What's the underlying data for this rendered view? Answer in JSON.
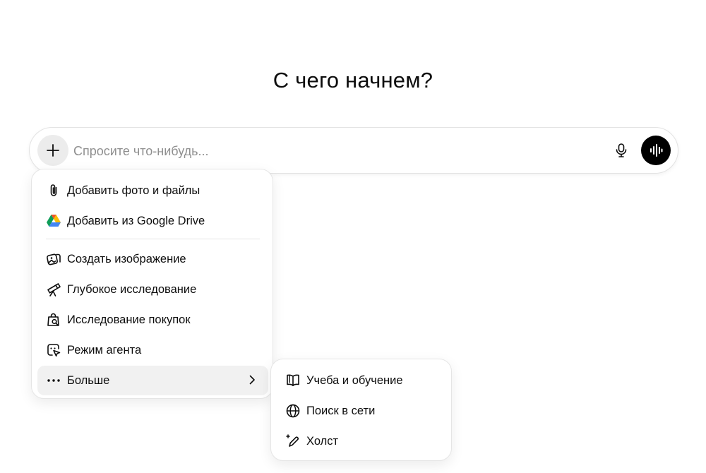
{
  "heading": "С чего начнем?",
  "composer": {
    "placeholder": "Спросите что-нибудь...",
    "value": "",
    "plus_icon": "plus-icon",
    "mic_icon": "microphone-icon",
    "voice_icon": "voice-mode-icon"
  },
  "menu": {
    "items": [
      {
        "label": "Добавить фото и файлы",
        "icon": "paperclip-icon"
      },
      {
        "label": "Добавить из Google Drive",
        "icon": "google-drive-icon"
      },
      {
        "label": "Создать изображение",
        "icon": "image-create-icon"
      },
      {
        "label": "Глубокое исследование",
        "icon": "telescope-icon"
      },
      {
        "label": "Исследование покупок",
        "icon": "shopping-bag-search-icon"
      },
      {
        "label": "Режим агента",
        "icon": "agent-cursor-icon"
      },
      {
        "label": "Больше",
        "icon": "ellipsis-icon",
        "has_submenu": true
      }
    ]
  },
  "submenu": {
    "items": [
      {
        "label": "Учеба и обучение",
        "icon": "book-icon"
      },
      {
        "label": "Поиск в сети",
        "icon": "globe-icon"
      },
      {
        "label": "Холст",
        "icon": "canvas-pen-icon"
      }
    ]
  },
  "colors": {
    "voice_button": "#000000",
    "plus_button_bg": "#ececec",
    "active_item_bg": "#f1f1f1",
    "placeholder": "#8f8f8f"
  }
}
